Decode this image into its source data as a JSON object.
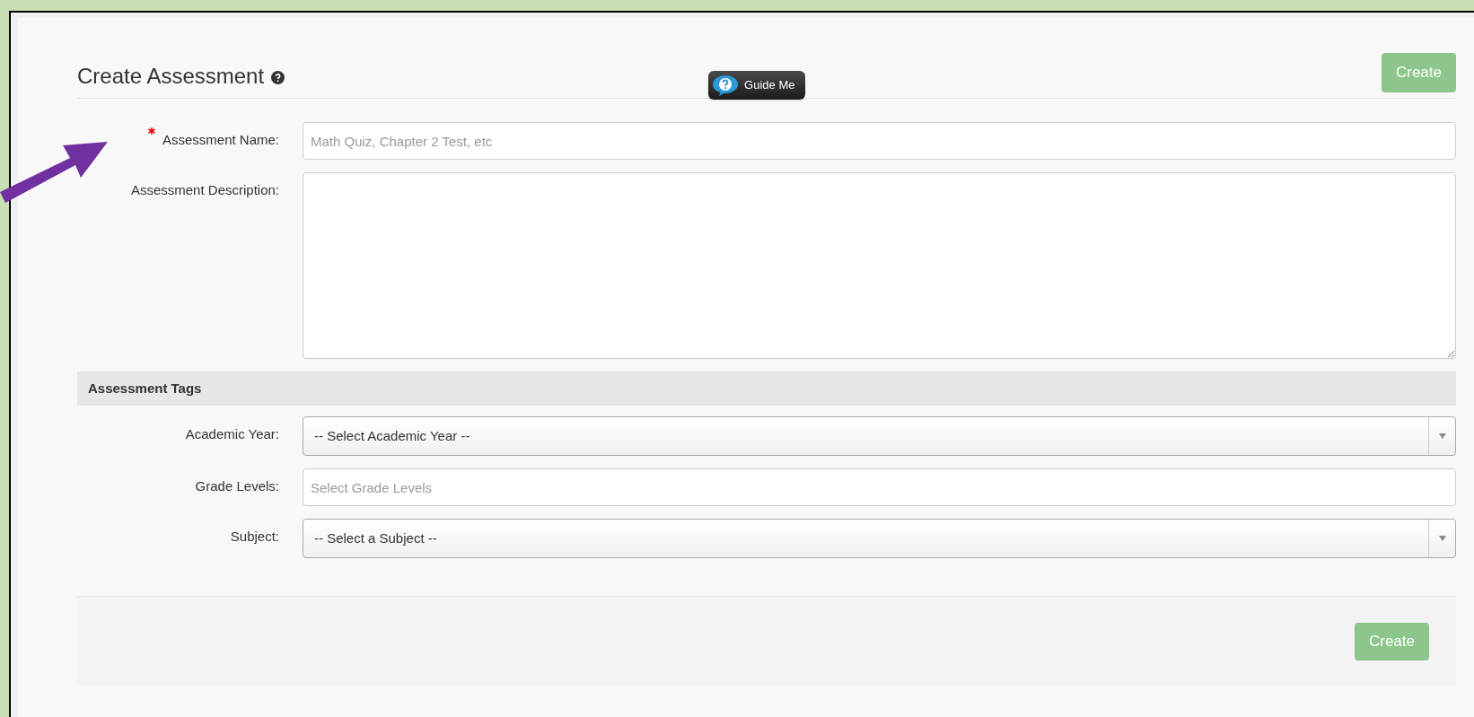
{
  "header": {
    "title": "Create Assessment",
    "guide_button": "Guide Me",
    "create_button": "Create"
  },
  "fields": [
    {
      "kind": "text",
      "label": "Assessment Name:",
      "required": true,
      "placeholder": "Math Quiz, Chapter 2 Test, etc"
    },
    {
      "kind": "textarea",
      "label": "Assessment Description:",
      "required": false
    }
  ],
  "tags_section": {
    "title": "Assessment Tags",
    "fields": [
      {
        "kind": "select",
        "label": "Academic Year:",
        "value": "-- Select Academic Year --"
      },
      {
        "kind": "text",
        "label": "Grade Levels:",
        "placeholder": "Select Grade Levels"
      },
      {
        "kind": "select",
        "label": "Subject:",
        "value": "-- Select a Subject --"
      }
    ]
  },
  "footer": {
    "create_button": "Create"
  }
}
